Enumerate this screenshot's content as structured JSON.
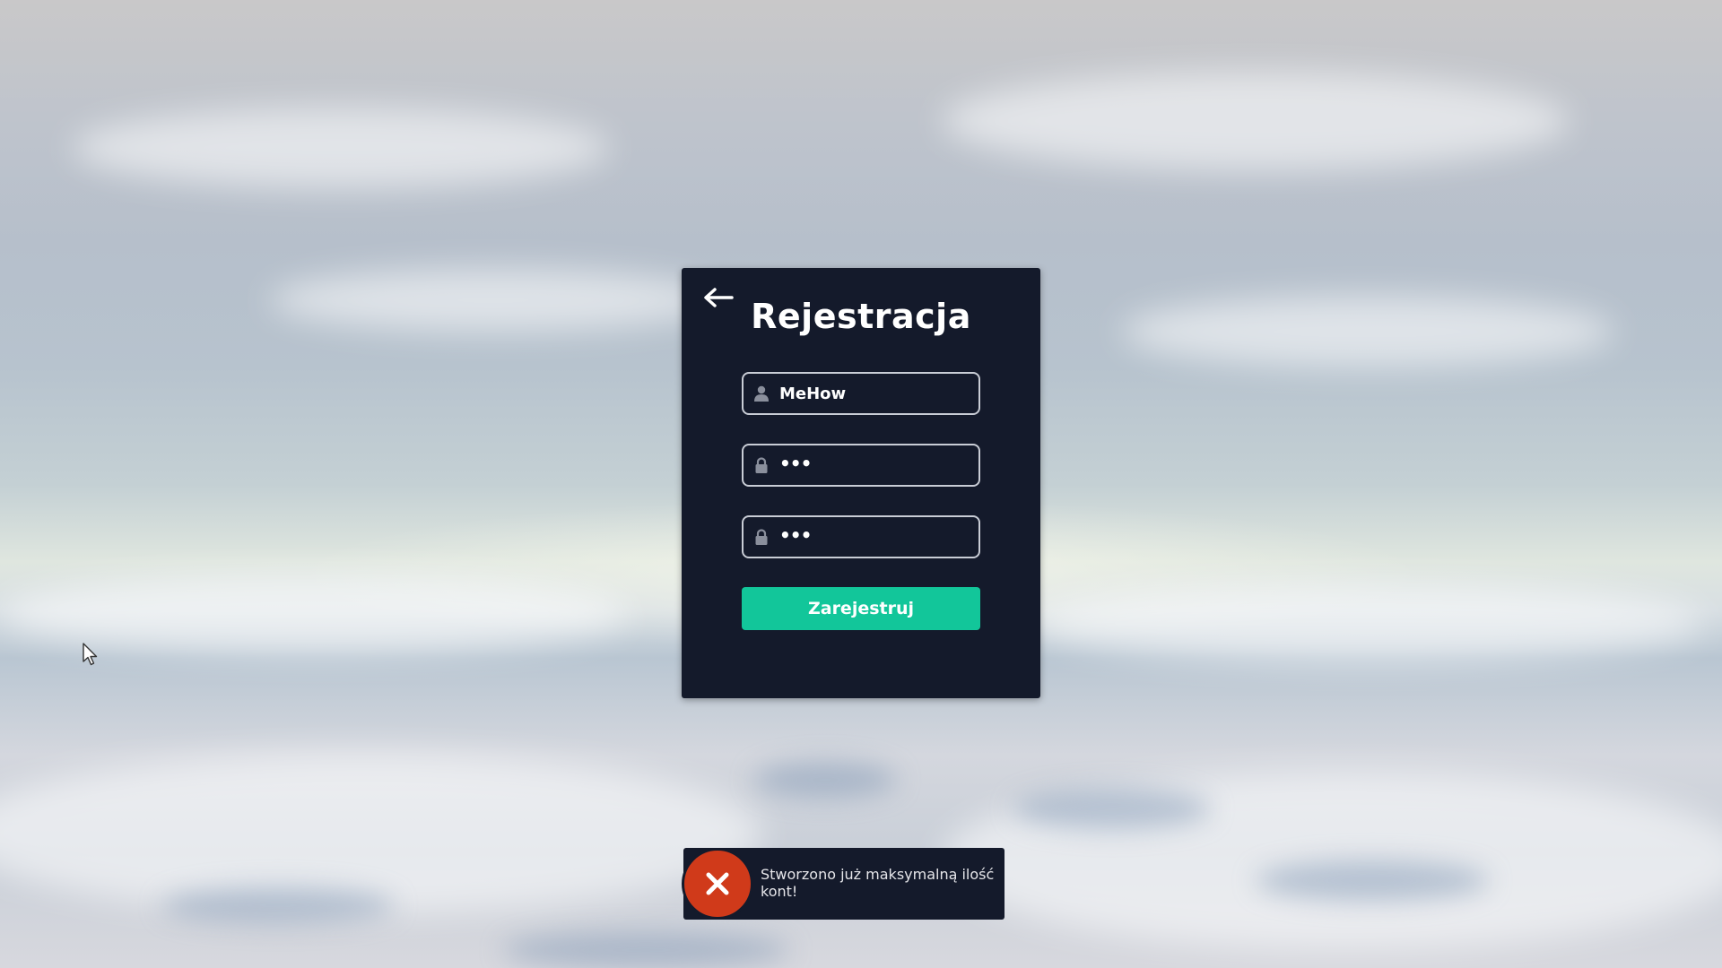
{
  "form": {
    "title": "Rejestracja",
    "username_value": "MeHow",
    "password_value": "•••",
    "confirm_password_value": "•••",
    "submit_label": "Zarejestruj"
  },
  "notification": {
    "message": "Stworzono już maksymalną ilość kont!"
  },
  "colors": {
    "panel_bg": "#141a2b",
    "accent": "#12c69a",
    "error": "#d03a1a"
  },
  "icons": {
    "back": "arrow-left-icon",
    "user": "user-icon",
    "password": "lock-icon",
    "confirm_password": "lock-icon",
    "error": "close-icon"
  }
}
